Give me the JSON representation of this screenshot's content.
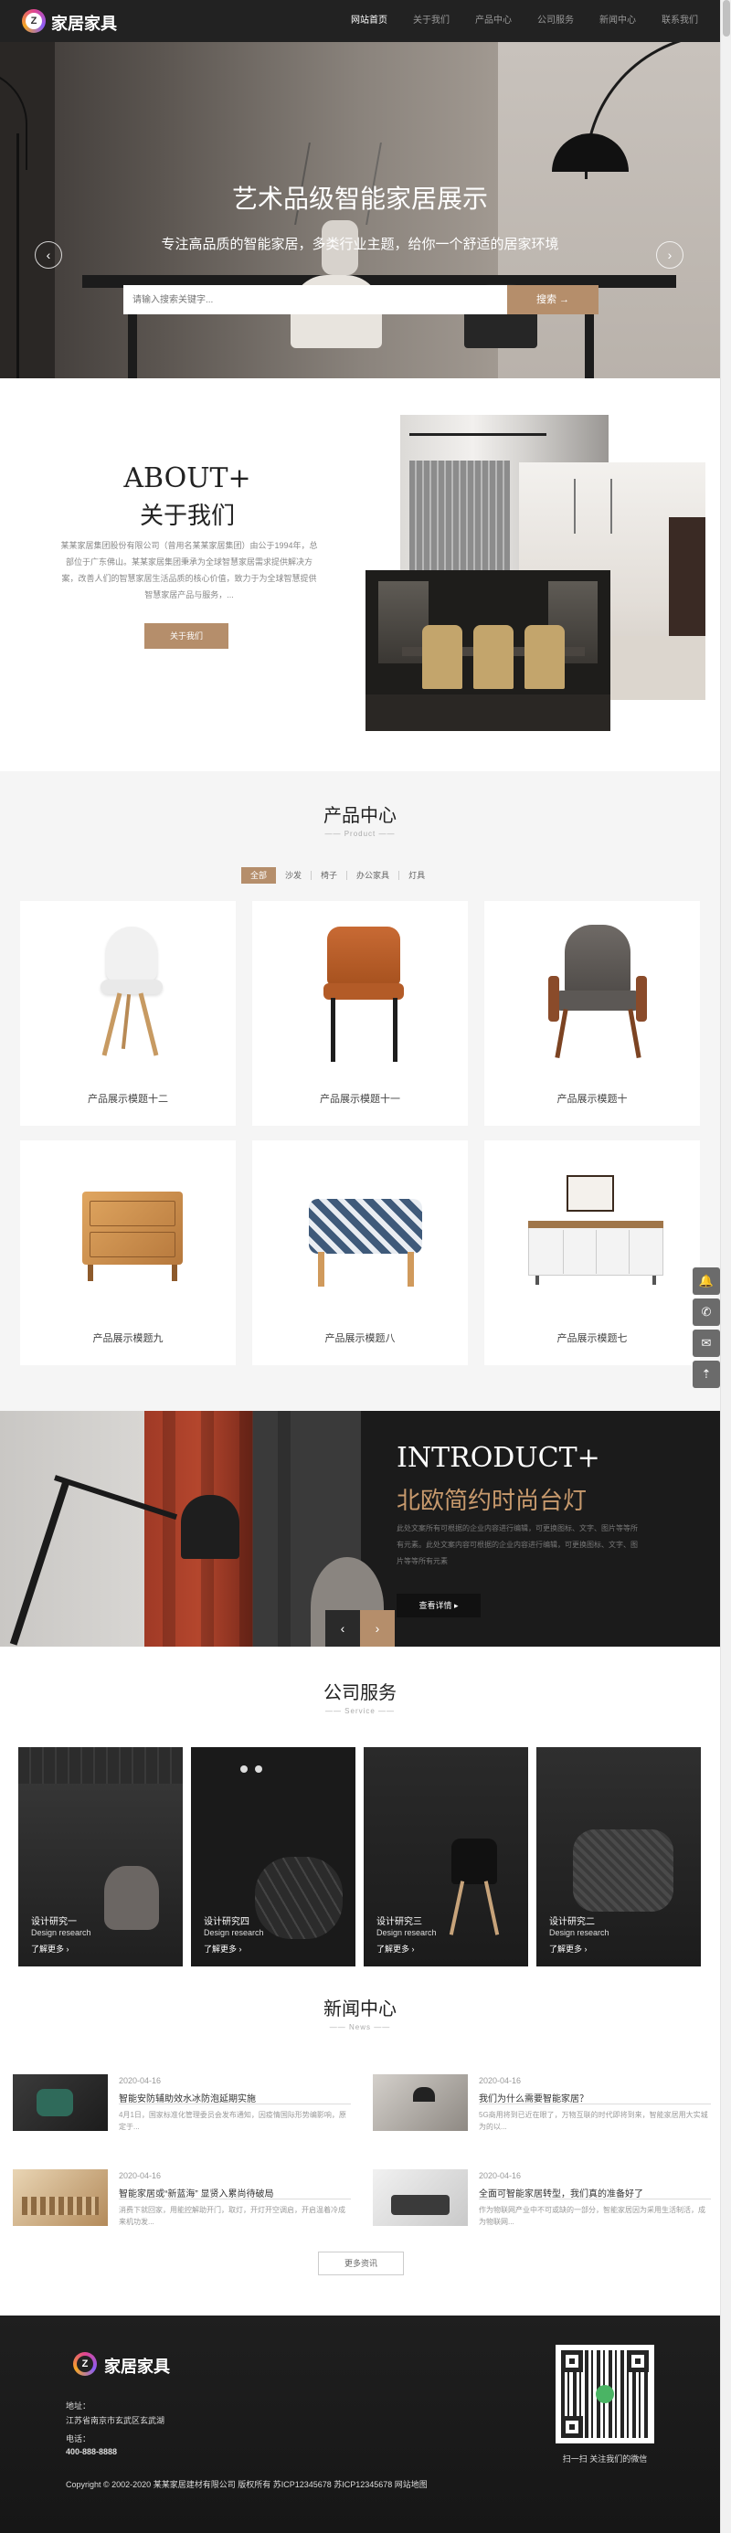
{
  "header": {
    "logo_letter": "Z",
    "logo_text": "家居家具",
    "nav": [
      "网站首页",
      "关于我们",
      "产品中心",
      "公司服务",
      "新闻中心",
      "联系我们"
    ],
    "active_nav_index": 0
  },
  "hero": {
    "title": "艺术品级智能家居展示",
    "subtitle": "专注高品质的智能家居，多类行业主题，给你一个舒适的居家环境",
    "search_placeholder": "请输入搜索关键字...",
    "search_button": "搜索",
    "prev_arrow": "‹",
    "next_arrow": "›",
    "slide_count": 3,
    "active_slide": 1
  },
  "about": {
    "title_en": "ABOUT+",
    "title_cn": "关于我们",
    "description": "某某家居集团股份有限公司（曾用名某某家居集团）由公于1994年，总部位于广东佛山。某某家居集团秉承为全球智慧家居需求提供解决方案，改善人们的智慧家居生活品质的核心价值，致力于为全球智慧提供智慧家居产品与服务，...",
    "button": "关于我们"
  },
  "products": {
    "title": "产品中心",
    "subtitle": "—— Product ——",
    "tabs": [
      "全部",
      "沙发",
      "椅子",
      "办公家具",
      "灯具"
    ],
    "active_tab_index": 0,
    "items": [
      {
        "name": "产品展示模题十二"
      },
      {
        "name": "产品展示模题十一"
      },
      {
        "name": "产品展示模题十"
      },
      {
        "name": "产品展示模题九"
      },
      {
        "name": "产品展示模题八"
      },
      {
        "name": "产品展示模题七"
      }
    ]
  },
  "side_tools": {
    "icons": [
      "bell-icon",
      "phone-icon",
      "wechat-icon",
      "back-to-top-icon"
    ],
    "glyphs": [
      "🔔",
      "✆",
      "✉",
      "⇡"
    ]
  },
  "intro": {
    "title_en": "INTRODUCT+",
    "title_cn": "北欧简约时尚台灯",
    "description": "此处文案所有可根据的企业内容进行编辑，可更换图标、文字、图片等等所有元素。此处文案内容可根据的企业内容进行编辑，可更换图标、文字、图片等等所有元素",
    "button": "查看详情 ▸",
    "prev": "‹",
    "next": "›"
  },
  "services": {
    "title": "公司服务",
    "subtitle": "—— Service ——",
    "items": [
      {
        "title": "设计研究一",
        "en": "Design research",
        "more": "了解更多 ›"
      },
      {
        "title": "设计研究四",
        "en": "Design research",
        "more": "了解更多 ›"
      },
      {
        "title": "设计研究三",
        "en": "Design research",
        "more": "了解更多 ›"
      },
      {
        "title": "设计研究二",
        "en": "Design research",
        "more": "了解更多 ›"
      }
    ]
  },
  "news": {
    "title": "新闻中心",
    "subtitle": "—— News ——",
    "items": [
      {
        "date": "2020-04-16",
        "title": "智能安防辅助效水冰防泡延期实施",
        "desc": "4月1日，国家标准化管理委员会发布通知，因疫情国际形势编影响，原定于..."
      },
      {
        "date": "2020-04-16",
        "title": "我们为什么需要智能家居？",
        "desc": "5G商用将到已近在眼了，万物互联的时代即将到来，智能家居用大实城为的以..."
      },
      {
        "date": "2020-04-16",
        "title": "智能家居或“新蓝海” 显贤入累尚待破局",
        "desc": "消费下就回家，用能控解助开门，取灯，开灯开空调启，开启温着冷成来机功发..."
      },
      {
        "date": "2020-04-16",
        "title": "全面可智能家居转型，我们真的准备好了",
        "desc": "作为物联网产业中不可或缺的一部分，智能家居因为采用生活制活，成为物联网..."
      }
    ],
    "more_button": "更多资讯"
  },
  "footer": {
    "logo_letter": "Z",
    "logo_text": "家居家具",
    "address_label": "地址：",
    "address": "江苏省南京市玄武区玄武湖",
    "phone_label": "电话：",
    "phone": "400-888-8888",
    "qr_caption": "扫一扫 关注我们的微信",
    "copyright": "Copyright © 2002-2020 某某家居建材有限公司 版权所有 苏ICP12345678 苏ICP12345678 网站地图"
  }
}
